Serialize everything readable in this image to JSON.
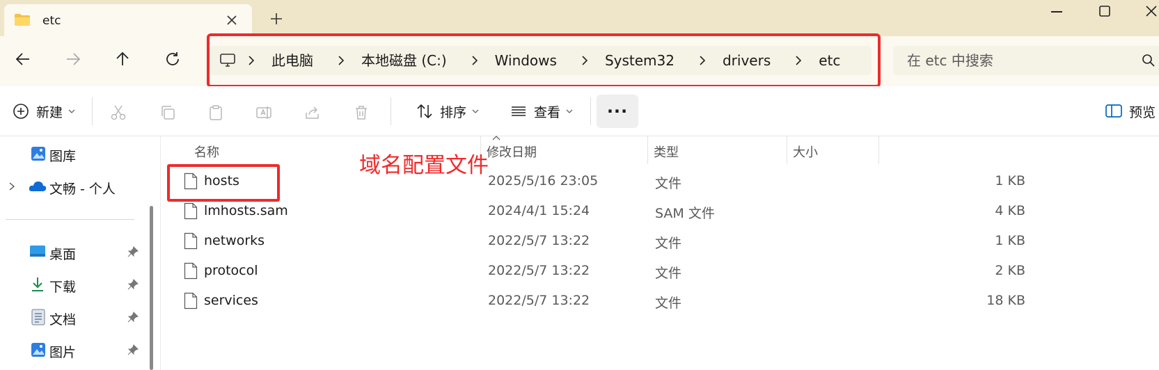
{
  "tab": {
    "title": "etc",
    "icon": "folder-icon"
  },
  "navigation": {
    "back": "arrow-left-icon",
    "forward": "arrow-right-icon",
    "up": "arrow-up-icon",
    "refresh": "refresh-icon"
  },
  "breadcrumb": [
    "此电脑",
    "本地磁盘 (C:)",
    "Windows",
    "System32",
    "drivers",
    "etc"
  ],
  "search": {
    "placeholder": "在 etc 中搜索"
  },
  "toolbar": {
    "new_label": "新建",
    "sort_label": "排序",
    "view_label": "查看",
    "more_label": "···",
    "preview_label": "预览"
  },
  "sidebar": {
    "items": [
      {
        "label": "图库",
        "icon": "gallery-icon"
      },
      {
        "label": "文畅 - 个人",
        "icon": "onedrive-cloud-icon"
      },
      {
        "label": "桌面",
        "icon": "desktop-icon",
        "pinned": true
      },
      {
        "label": "下载",
        "icon": "download-icon",
        "pinned": true
      },
      {
        "label": "文档",
        "icon": "documents-icon",
        "pinned": true
      },
      {
        "label": "图片",
        "icon": "pictures-icon",
        "pinned": true
      }
    ]
  },
  "columns": {
    "name": "名称",
    "date": "修改日期",
    "type": "类型",
    "size": "大小"
  },
  "files": [
    {
      "name": "hosts",
      "date": "2025/5/16 23:05",
      "type": "文件",
      "size": "1 KB"
    },
    {
      "name": "lmhosts.sam",
      "date": "2024/4/1 15:24",
      "type": "SAM 文件",
      "size": "4 KB"
    },
    {
      "name": "networks",
      "date": "2022/5/7 13:22",
      "type": "文件",
      "size": "1 KB"
    },
    {
      "name": "protocol",
      "date": "2022/5/7 13:22",
      "type": "文件",
      "size": "2 KB"
    },
    {
      "name": "services",
      "date": "2022/5/7 13:22",
      "type": "文件",
      "size": "18 KB"
    }
  ],
  "annotation": {
    "text": "域名配置文件",
    "color": "#ee2b2b"
  },
  "colors": {
    "titlebar": "#efe6c9",
    "toolbar_bg": "#fbf9f0",
    "highlight": "#ee2b2b",
    "accent": "#0067c0"
  }
}
